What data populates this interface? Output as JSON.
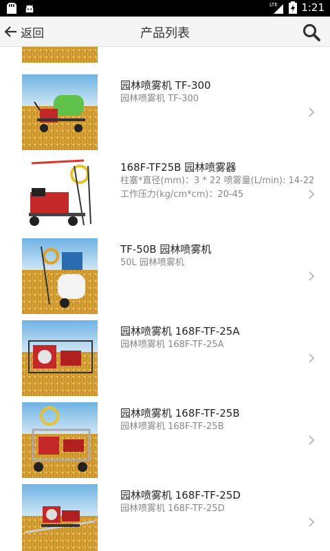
{
  "status_bar": {
    "network": "LTE",
    "time": "1:21",
    "icons": [
      "sd-card-icon",
      "android-icon",
      "signal-icon",
      "battery-icon"
    ]
  },
  "header": {
    "back_label": "返回",
    "title": "产品列表",
    "search_icon": "search-icon"
  },
  "products": [
    {
      "name": "园林喷雾机 TF-300",
      "desc": [
        "园林喷雾机 TF-300"
      ],
      "image": "green-tank-sprayer"
    },
    {
      "name": "168F-TF25B 园林喷雾器",
      "desc": [
        "柱塞*直径(mm)：3 * 22 喷雾量(L/min): 14-22",
        "工作压力(kg/cm*cm)：20-45"
      ],
      "image": "red-engine-cart-sprayer"
    },
    {
      "name": "TF-50B 园林喷雾机",
      "desc": [
        "50L 园林喷雾机"
      ],
      "image": "white-tank-cart-sprayer"
    },
    {
      "name": "园林喷雾机 168F-TF-25A",
      "desc": [
        "园林喷雾机 168F-TF-25A"
      ],
      "image": "red-engine-frame-sprayer"
    },
    {
      "name": "园林喷雾机 168F-TF-25B",
      "desc": [
        "园林喷雾机 168F-TF-25B"
      ],
      "image": "cart-hose-reel-sprayer"
    },
    {
      "name": "园林喷雾机 168F-TF-25D",
      "desc": [
        "园林喷雾机 168F-TF-25D"
      ],
      "image": "red-engine-boom-sprayer"
    }
  ],
  "colors": {
    "sky": "#8fc3e6",
    "wheat": "#d9a437",
    "accent_text": "#222222"
  }
}
